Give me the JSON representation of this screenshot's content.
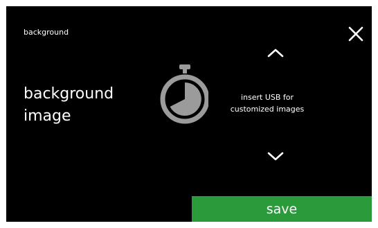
{
  "header": {
    "title": "background"
  },
  "setting": {
    "label_line1": "background",
    "label_line2": "image"
  },
  "message": {
    "line1": "insert USB for",
    "line2": "customized images"
  },
  "icons": {
    "close": "close-icon",
    "up": "chevron-up-icon",
    "down": "chevron-down-icon",
    "timer": "stopwatch-icon"
  },
  "actions": {
    "save_label": "save"
  },
  "colors": {
    "background": "#000000",
    "text": "#ffffff",
    "accent": "#2b9a3a",
    "icon": "#9b9b9b"
  }
}
